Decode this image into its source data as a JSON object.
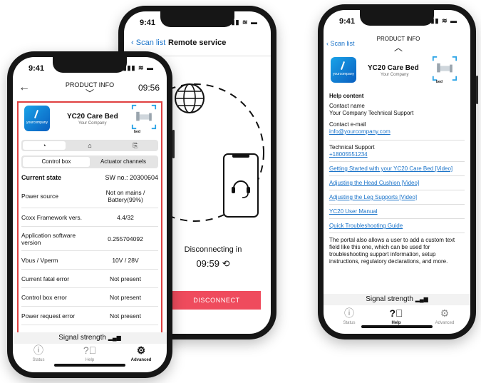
{
  "phone_status": {
    "time": "9:41",
    "icons": "▮▮▮ ≋ ▬"
  },
  "middle": {
    "back_label": "Scan list",
    "title": "Remote service",
    "disconnecting_label": "Disconnecting in",
    "timer": "09:59",
    "disconnect_label": "DISCONNECT"
  },
  "left": {
    "title": "PRODUCT INFO",
    "clock": "09:56",
    "logo_text": "yourcompany",
    "product_name": "YC20 Care Bed",
    "company": "Your Company",
    "bed_label": "bed",
    "segments": [
      "Control box",
      "Actuator channels"
    ],
    "current_state_label": "Current state",
    "sw_no": "SW no.: 20300604",
    "rows": [
      {
        "label": "Power source",
        "value": "Not on mains / Battery(99%)"
      },
      {
        "label": "Coxx Framework vers.",
        "value": "4.4/32"
      },
      {
        "label": "Application software version",
        "value": "0.255704092"
      },
      {
        "label": "Vbus / Vperm",
        "value": "10V / 28V"
      },
      {
        "label": "Current fatal error",
        "value": "Not present"
      },
      {
        "label": "Control box error",
        "value": "Not present"
      },
      {
        "label": "Power request error",
        "value": "Not present"
      }
    ],
    "signal": "Signal strength",
    "tabs": [
      "Status",
      "Help",
      "Advanced"
    ]
  },
  "right": {
    "back_label": "Scan list",
    "title": "PRODUCT INFO",
    "logo_text": "yourcompany",
    "product_name": "YC20 Care Bed",
    "company": "Your Company",
    "bed_label": "bed",
    "help_heading": "Help content",
    "contact_name_label": "Contact name",
    "contact_name": "Your Company Technical Support",
    "contact_email_label": "Contact e-mail",
    "contact_email": "info@yourcompany.com",
    "support_label": "Technical Support",
    "support_phone": "+18005551234",
    "links": [
      "Getting Started with your YC20 Care Bed [Video]",
      "Adjusting the Head Cushion [Video]",
      "Adjusting the Leg Supports [Video]",
      "YC20 User Manual",
      "Quick Troubleshooting Guide"
    ],
    "custom_text": "The portal also allows a user to add a custom text field like this one, which can be used for troubleshooting support information, setup instructions, regulatory declarations, and more.",
    "signal": "Signal strength",
    "tabs": [
      "Status",
      "Help",
      "Advanced"
    ]
  }
}
